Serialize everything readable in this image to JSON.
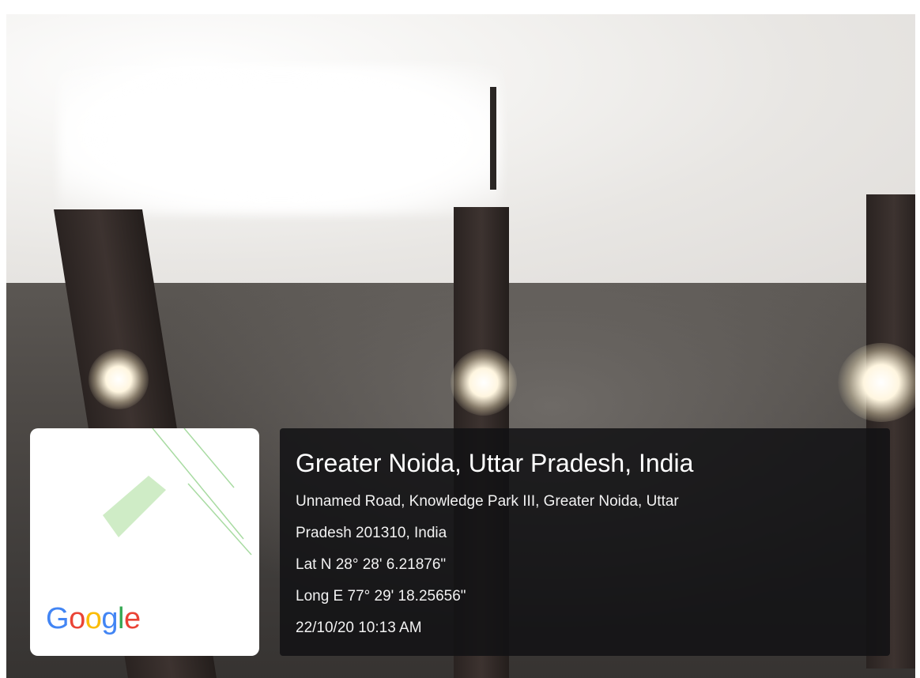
{
  "map_card": {
    "logo_letters": [
      "G",
      "o",
      "o",
      "g",
      "l",
      "e"
    ],
    "logo_colors": [
      "#4285f4",
      "#ea4335",
      "#fbbc05",
      "#4285f4",
      "#34a853",
      "#ea4335"
    ],
    "map_road_color": "#a8dba2",
    "map_area_color": "#cfecc6"
  },
  "location": {
    "title": "Greater Noida, Uttar Pradesh, India",
    "address_line_1": "Unnamed Road, Knowledge Park III, Greater Noida, Uttar",
    "address_line_2": "Pradesh 201310, India",
    "latitude": "Lat N 28° 28' 6.21876\"",
    "longitude": "Long E 77° 29' 18.25656\"",
    "timestamp": "22/10/20 10:13 AM"
  }
}
